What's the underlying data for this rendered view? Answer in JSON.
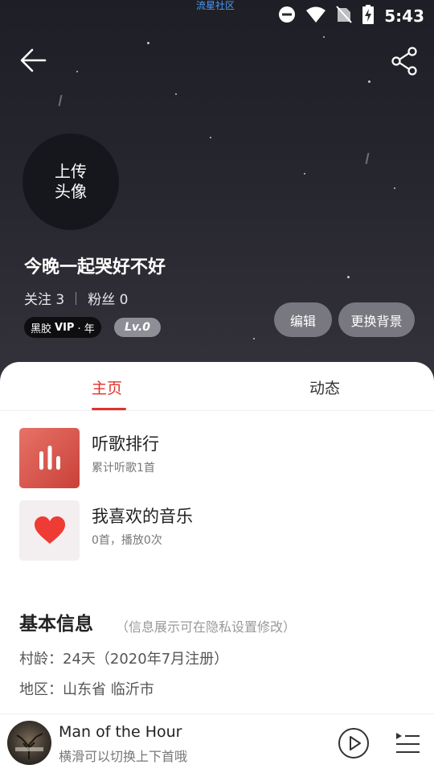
{
  "status_bar": {
    "carrier": "流星社区",
    "time": "5:43",
    "icons": [
      "do-not-disturb-icon",
      "wifi-icon",
      "no-sim-icon",
      "battery-charging-icon"
    ]
  },
  "header": {
    "back_icon": "back-arrow-icon",
    "share_icon": "share-icon"
  },
  "profile": {
    "avatar_label": "上传头像",
    "username": "今晚一起哭好不好",
    "follow_label": "关注",
    "follow_count": "3",
    "fans_label": "粉丝",
    "fans_count": "0",
    "vip_text": "黑胶",
    "vip_brand": "VIP",
    "vip_suffix": "· 年",
    "level": "Lv.0",
    "edit_label": "编辑",
    "change_bg_label": "更换背景"
  },
  "tabs": [
    {
      "label": "主页",
      "active": true
    },
    {
      "label": "动态",
      "active": false
    }
  ],
  "lists": [
    {
      "title": "听歌排行",
      "subtitle": "累计听歌1首",
      "icon": "ranking-bars-icon"
    },
    {
      "title": "我喜欢的音乐",
      "subtitle": "0首，播放0次",
      "icon": "heart-icon"
    }
  ],
  "basic_info": {
    "title": "基本信息",
    "hint": "（信息展示可在隐私设置修改）",
    "age_row": "村龄：24天（2020年7月注册）",
    "region_row": "地区：山东省 临沂市"
  },
  "player": {
    "song_title": "Man of the Hour",
    "hint": "横滑可以切换上下首哦",
    "play_icon": "play-circle-icon",
    "queue_icon": "playlist-icon"
  },
  "colors": {
    "accent": "#e0322c",
    "hero_bg": "#26262e"
  }
}
